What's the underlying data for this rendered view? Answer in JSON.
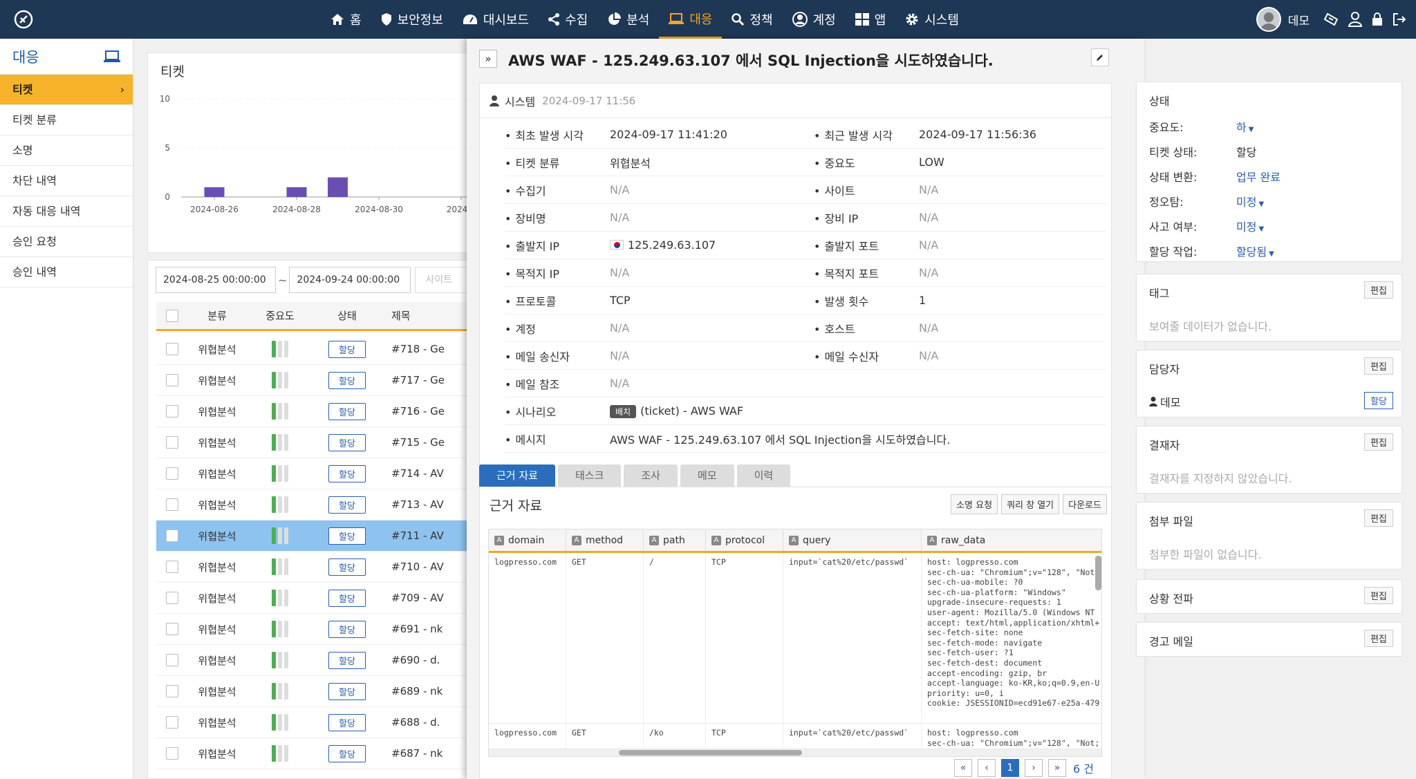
{
  "nav": {
    "items": [
      {
        "label": "홈",
        "icon": "home-icon"
      },
      {
        "label": "보안정보",
        "icon": "shield-icon"
      },
      {
        "label": "대시보드",
        "icon": "dashboard-icon"
      },
      {
        "label": "수집",
        "icon": "share-icon"
      },
      {
        "label": "분석",
        "icon": "pie-chart-icon"
      },
      {
        "label": "대응",
        "icon": "laptop-icon"
      },
      {
        "label": "정책",
        "icon": "search-icon"
      },
      {
        "label": "계정",
        "icon": "user-circle-icon"
      },
      {
        "label": "앱",
        "icon": "apps-grid-icon"
      },
      {
        "label": "시스템",
        "icon": "gear-icon"
      }
    ],
    "active": "대응",
    "user_name": "데모"
  },
  "sidebar": {
    "title": "대응",
    "items": [
      {
        "label": "티켓",
        "chevron": "›"
      },
      {
        "label": "티켓 분류"
      },
      {
        "label": "소명"
      },
      {
        "label": "차단 내역"
      },
      {
        "label": "자동 대응 내역"
      },
      {
        "label": "승인 요청"
      },
      {
        "label": "승인 내역"
      }
    ]
  },
  "chart": {
    "title": "티켓"
  },
  "chart_data": {
    "type": "bar",
    "categories": [
      "2024-08-26",
      "2024-08-28",
      "2024-08-30",
      "2024-0"
    ],
    "x": [
      "2024-08-26",
      "2024-08-28",
      "2024-08-29",
      "2024-08-30"
    ],
    "values": [
      1,
      1,
      2,
      0
    ],
    "ylim": [
      0,
      10
    ],
    "yticks": [
      "10",
      "5",
      "0"
    ],
    "bar_color": "#6a4fb3"
  },
  "filters": {
    "from": "2024-08-25 00:00:00",
    "tilde": "~",
    "to": "2024-09-24 00:00:00",
    "site_placeholder": "사이트"
  },
  "table": {
    "headers": {
      "category": "분류",
      "severity": "중요도",
      "status": "상태",
      "title": "제목"
    },
    "rows": [
      {
        "category": "위협분석",
        "status": "할당",
        "title": "#718 - Ge"
      },
      {
        "category": "위협분석",
        "status": "할당",
        "title": "#717 - Ge"
      },
      {
        "category": "위협분석",
        "status": "할당",
        "title": "#716 - Ge"
      },
      {
        "category": "위협분석",
        "status": "할당",
        "title": "#715 - Ge"
      },
      {
        "category": "위협분석",
        "status": "할당",
        "title": "#714 - AV"
      },
      {
        "category": "위협분석",
        "status": "할당",
        "title": "#713 - AV"
      },
      {
        "category": "위협분석",
        "status": "할당",
        "title": "#711 - AV"
      },
      {
        "category": "위협분석",
        "status": "할당",
        "title": "#710 - AV"
      },
      {
        "category": "위협분석",
        "status": "할당",
        "title": "#709 - AV"
      },
      {
        "category": "위협분석",
        "status": "할당",
        "title": "#691 - nk"
      },
      {
        "category": "위협분석",
        "status": "할당",
        "title": "#690 - d."
      },
      {
        "category": "위협분석",
        "status": "할당",
        "title": "#689 - nk"
      },
      {
        "category": "위협분석",
        "status": "할당",
        "title": "#688 - d."
      },
      {
        "category": "위협분석",
        "status": "할당",
        "title": "#687 - nk"
      }
    ]
  },
  "detail": {
    "collapse": "»",
    "title": "AWS WAF - 125.249.63.107 에서 SQL Injection을 시도하였습니다.",
    "author": "시스템",
    "created": "2024-09-17 11:56",
    "fields": [
      {
        "l1": "최초 발생 시각",
        "v1": "2024-09-17 11:41:20",
        "l2": "최근 발생 시각",
        "v2": "2024-09-17 11:56:36"
      },
      {
        "l1": "티켓 분류",
        "v1": "위협분석",
        "l2": "중요도",
        "v2": "LOW"
      },
      {
        "l1": "수집기",
        "v1": "N/A",
        "l2": "사이트",
        "v2": "N/A"
      },
      {
        "l1": "장비명",
        "v1": "N/A",
        "l2": "장비 IP",
        "v2": "N/A"
      },
      {
        "l1": "출발지 IP",
        "v1": "125.249.63.107",
        "l2": "출발지 포트",
        "v2": "N/A"
      },
      {
        "l1": "목적지 IP",
        "v1": "N/A",
        "l2": "목적지 포트",
        "v2": "N/A"
      },
      {
        "l1": "프로토콜",
        "v1": "TCP",
        "l2": "발생 횟수",
        "v2": "1"
      },
      {
        "l1": "계정",
        "v1": "N/A",
        "l2": "호스트",
        "v2": "N/A"
      },
      {
        "l1": "메일 송신자",
        "v1": "N/A",
        "l2": "메일 수신자",
        "v2": "N/A"
      },
      {
        "l1": "메일 참조",
        "v1": "N/A"
      },
      {
        "l1": "시나리오",
        "v1_tag": "배치",
        "v1": "(ticket) - AWS WAF"
      },
      {
        "l1": "메시지",
        "v1": "AWS WAF - 125.249.63.107 에서 SQL Injection을 시도하였습니다."
      }
    ]
  },
  "tabs": [
    "근거 자료",
    "태스크",
    "조사",
    "메모",
    "이력"
  ],
  "evidence": {
    "title": "근거 자료",
    "buttons": [
      "소명 요청",
      "쿼리 창 열기",
      "다운로드"
    ],
    "columns": [
      "domain",
      "method",
      "path",
      "protocol",
      "query",
      "raw_data"
    ],
    "rows": [
      {
        "domain": "logpresso.com",
        "method": "GET",
        "path": "/",
        "protocol": "TCP",
        "query": "input=`cat%20/etc/passwd`",
        "raw": "host: logpresso.com\nsec-ch-ua: \"Chromium\";v=\"128\", \"Not;\nsec-ch-ua-mobile: ?0\nsec-ch-ua-platform: \"Windows\"\nupgrade-insecure-requests: 1\nuser-agent: Mozilla/5.0 (Windows NT\naccept: text/html,application/xhtml+\nsec-fetch-site: none\nsec-fetch-mode: navigate\nsec-fetch-user: ?1\nsec-fetch-dest: document\naccept-encoding: gzip, br\naccept-language: ko-KR,ko;q=0.9,en-U\npriority: u=0, i\ncookie: JSESSIONID=ecd91e67-e25a-479"
      },
      {
        "domain": "logpresso.com",
        "method": "GET",
        "path": "/ko",
        "protocol": "TCP",
        "query": "input=`cat%20/etc/passwd`",
        "raw": "host: logpresso.com\nsec-ch-ua: \"Chromium\";v=\"128\", \"Not;"
      }
    ],
    "pager": {
      "first": "«",
      "prev": "‹",
      "page": "1",
      "next": "›",
      "last": "»",
      "count": "6 건"
    }
  },
  "status_card": {
    "title": "상태",
    "rows": [
      {
        "label": "중요도:",
        "value": "하"
      },
      {
        "label": "티켓 상태:",
        "value": "할당"
      },
      {
        "label": "상태 변환:",
        "value": "업무 완료"
      },
      {
        "label": "정오탐:",
        "value": "미정"
      },
      {
        "label": "사고 여부:",
        "value": "미정"
      },
      {
        "label": "할당 작업:",
        "value": "할당됨"
      }
    ]
  },
  "cards": {
    "edit": "편집",
    "tag_title": "태그",
    "tag_empty": "보여줄 데이터가 없습니다.",
    "assignee_title": "담당자",
    "assignee_name": "데모",
    "assignee_badge": "할당",
    "approver_title": "결재자",
    "approver_empty": "결재자를 지정하지 않았습니다.",
    "attach_title": "첨부 파일",
    "attach_empty": "첨부한 파일이 없습니다.",
    "escalation_title": "상황 전파",
    "alert_title": "경고 메일"
  }
}
